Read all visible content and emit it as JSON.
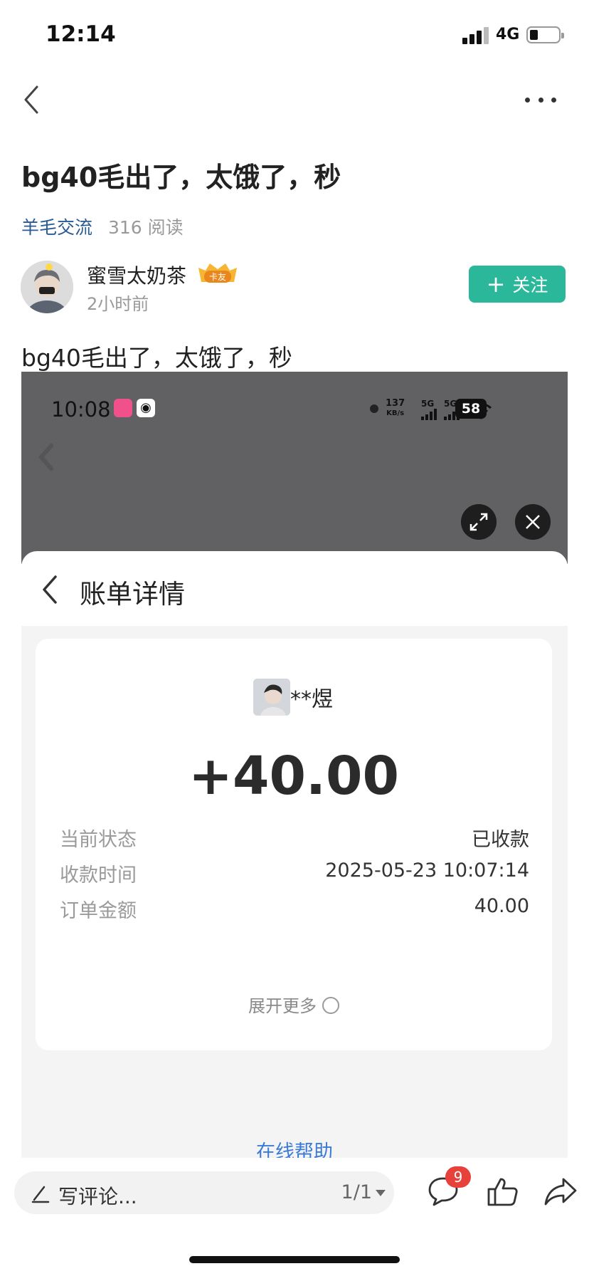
{
  "status_bar": {
    "time": "12:14",
    "network": "4G"
  },
  "post": {
    "title": "bg40毛出了，太饿了，秒",
    "category": "羊毛交流",
    "read_count": "316 阅读",
    "author": {
      "name": "蜜雪太奶茶",
      "badge": "卡友",
      "time": "2小时前"
    },
    "follow_label": "关注",
    "body": "bg40毛出了，太饿了，秒"
  },
  "screenshot": {
    "status_time": "10:08",
    "speed_value": "137",
    "speed_unit": "KB/s",
    "sig1_label": "5G",
    "sig2_label": "5G",
    "battery": "58",
    "sheet_title": "账单详情",
    "payer_name": "**煜",
    "amount": "+40.00",
    "details": [
      {
        "label": "当前状态",
        "value": "已收款"
      },
      {
        "label": "收款时间",
        "value": "2025-05-23 10:07:14"
      },
      {
        "label": "订单金额",
        "value": "40.00"
      }
    ],
    "expand_label": "展开更多",
    "help_label": "在线帮助"
  },
  "bottom_bar": {
    "comment_placeholder": "写评论...",
    "page_indicator": "1/1",
    "comment_count": "9"
  },
  "colors": {
    "follow": "#2bb79a",
    "category": "#2a5b93",
    "badge": "#e8413b",
    "help": "#3b7bd6"
  }
}
